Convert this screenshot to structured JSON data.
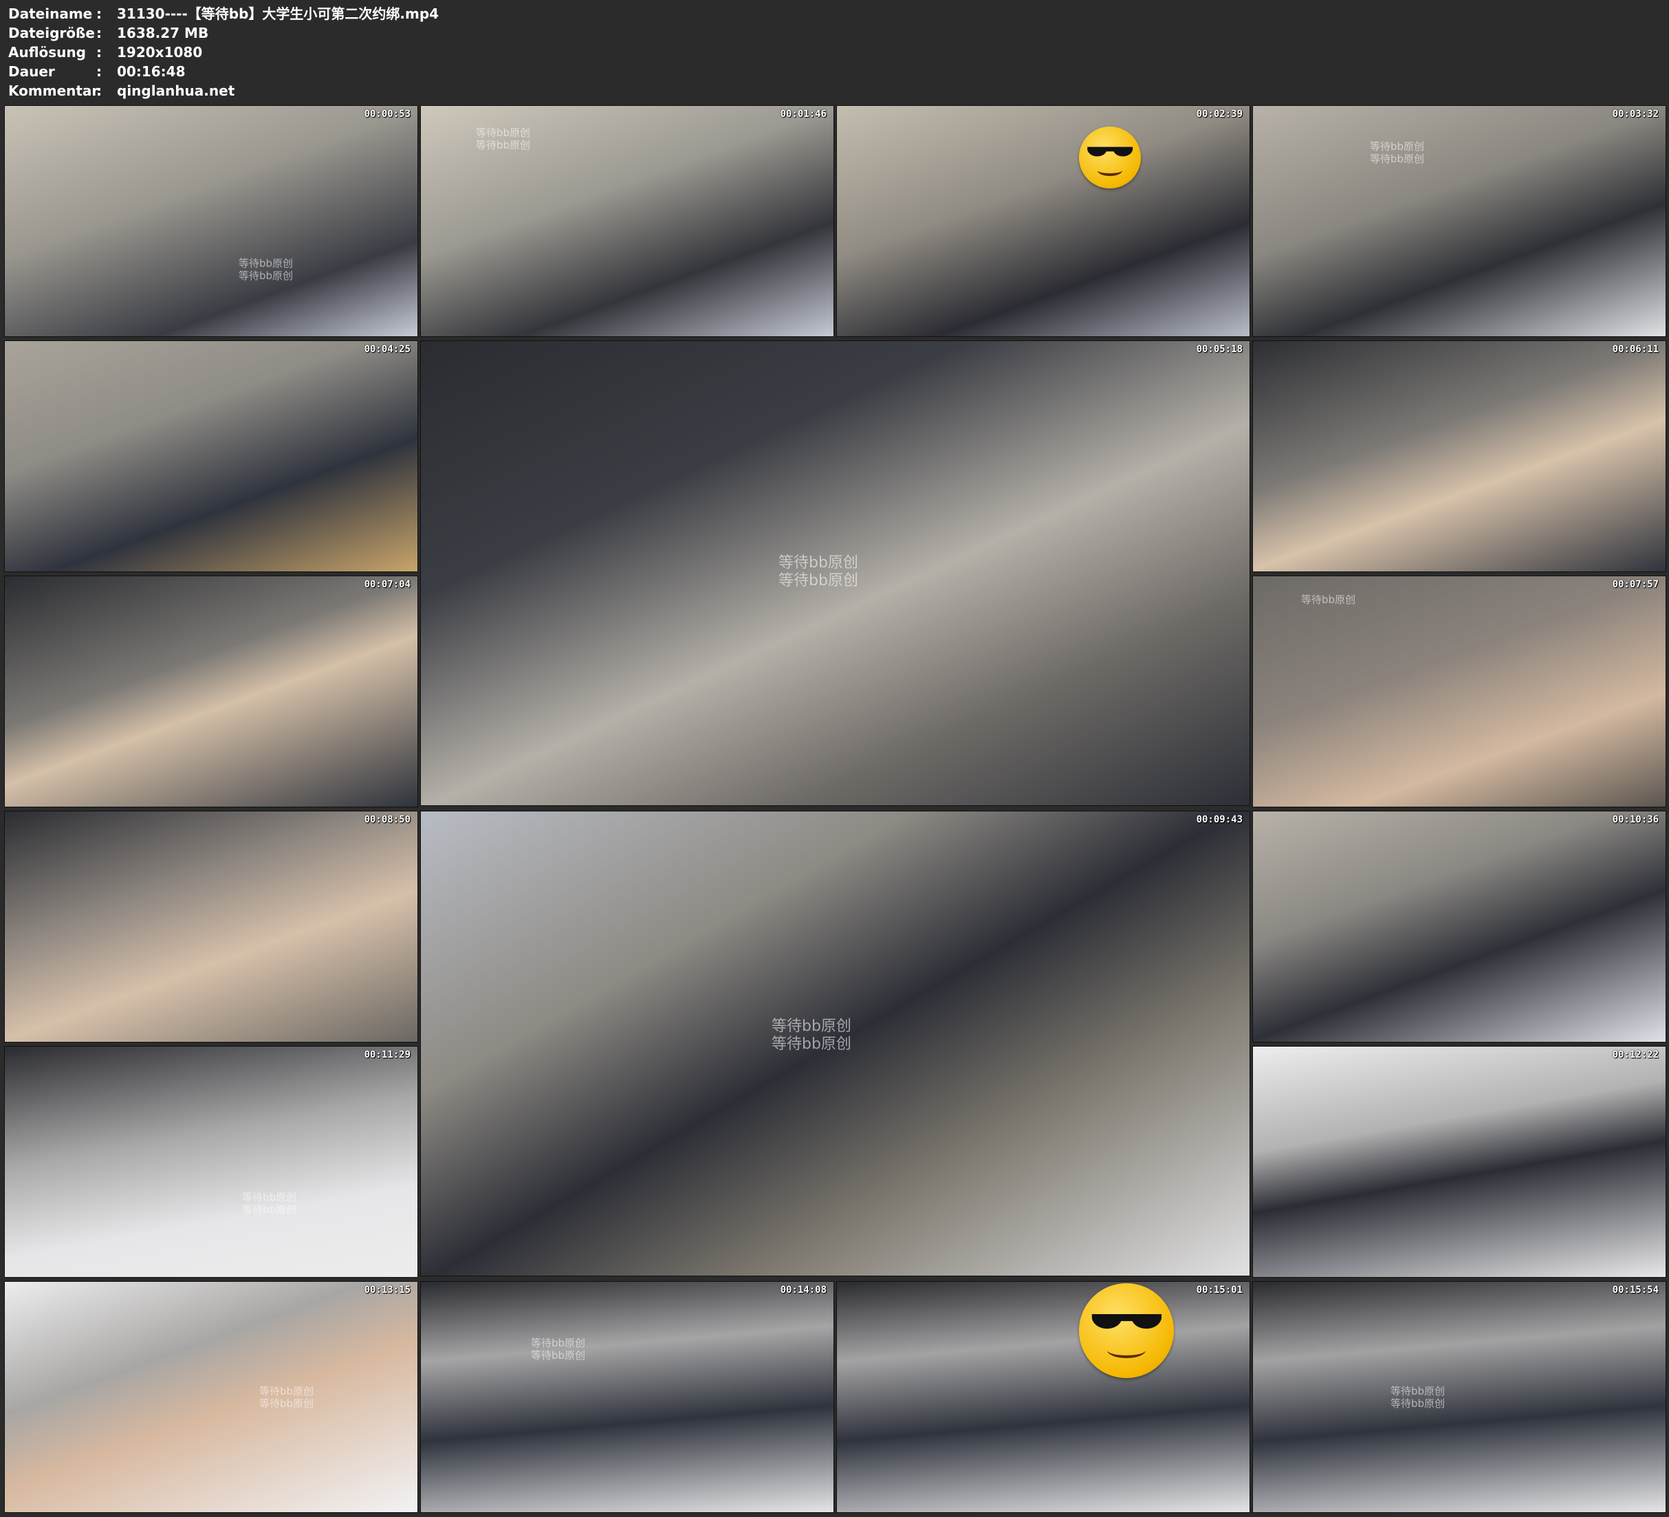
{
  "header": {
    "rows": [
      {
        "label": "Dateiname",
        "colon": ":",
        "value": "31130----【等待bb】大学生小可第二次约绑.mp4"
      },
      {
        "label": "Dateigröße",
        "colon": ":",
        "value": "1638.27 MB"
      },
      {
        "label": "Auflösung",
        "colon": ":",
        "value": "1920x1080"
      },
      {
        "label": "Dauer",
        "colon": ":",
        "value": "00:16:48"
      },
      {
        "label": "Kommentar",
        "colon": ":",
        "value": "qinglanhua.net"
      }
    ]
  },
  "watermark": {
    "line1": "等待bb原创",
    "line2": "等待bb原创"
  },
  "thumbnails": [
    {
      "time": "00:00:53",
      "bg": "#9a978f"
    },
    {
      "time": "00:01:46",
      "bg": "#9b9991"
    },
    {
      "time": "00:02:39",
      "bg": "#918c83"
    },
    {
      "time": "00:03:32",
      "bg": "#8a8780"
    },
    {
      "time": "00:04:25",
      "bg": "#8f8c86"
    },
    {
      "time": "00:05:18",
      "bg": "#6e6a66"
    },
    {
      "time": "00:06:11",
      "bg": "#7d7a76"
    },
    {
      "time": "00:07:04",
      "bg": "#7c7975"
    },
    {
      "time": "00:07:57",
      "bg": "#8b837c"
    },
    {
      "time": "00:08:50",
      "bg": "#8d8680"
    },
    {
      "time": "00:09:43",
      "bg": "#8e8a84"
    },
    {
      "time": "00:10:36",
      "bg": "#8b8883"
    },
    {
      "time": "00:11:29",
      "bg": "#a9a8a8"
    },
    {
      "time": "00:12:22",
      "bg": "#b3b2b2"
    },
    {
      "time": "00:13:15",
      "bg": "#a8a6a4"
    },
    {
      "time": "00:14:08",
      "bg": "#a6a5a6"
    },
    {
      "time": "00:15:01",
      "bg": "#a4a3a4"
    },
    {
      "time": "00:15:54",
      "bg": "#a3a2a3"
    }
  ]
}
